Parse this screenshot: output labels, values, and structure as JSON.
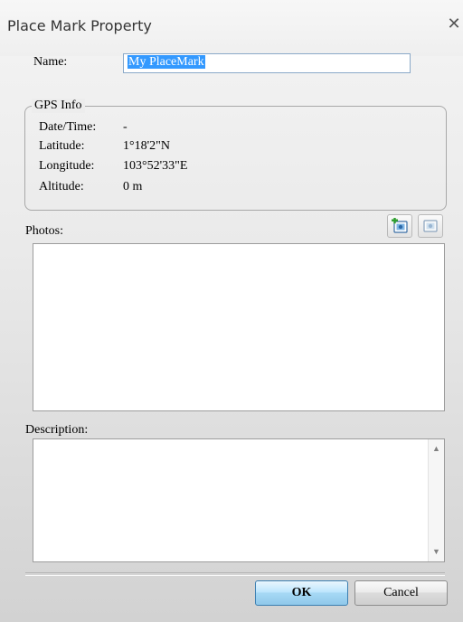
{
  "window": {
    "title": "Place Mark Property",
    "close_symbol": "✕"
  },
  "name": {
    "label": "Name:",
    "value": "My PlaceMark"
  },
  "gps": {
    "legend": "GPS Info",
    "rows": [
      {
        "label": "Date/Time:",
        "value": "-"
      },
      {
        "label": "Latitude:",
        "value": "1°18'2\"N"
      },
      {
        "label": "Longitude:",
        "value": "103°52'33\"E"
      },
      {
        "label": "Altitude:",
        "value": "0 m"
      }
    ]
  },
  "photos": {
    "label": "Photos:",
    "add_icon": "add-photo-icon",
    "remove_icon": "remove-photo-icon"
  },
  "description": {
    "label": "Description:",
    "value": ""
  },
  "buttons": {
    "ok": "OK",
    "cancel": "Cancel"
  }
}
